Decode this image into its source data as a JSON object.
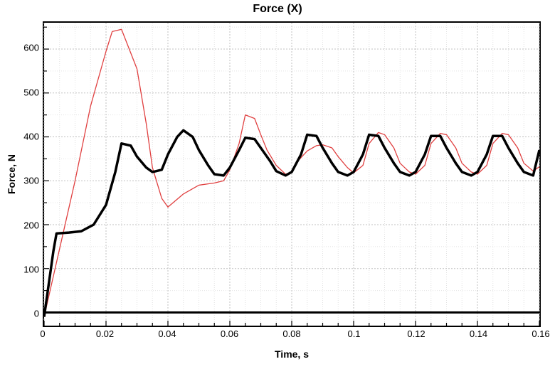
{
  "chart_data": {
    "type": "line",
    "title": "Force (X)",
    "xlabel": "Time, s",
    "ylabel": "Force, N",
    "xlim": [
      0,
      0.16
    ],
    "ylim": [
      -30,
      660
    ],
    "x_ticks_major": [
      0,
      0.02,
      0.04,
      0.06,
      0.08,
      0.1,
      0.12,
      0.14,
      0.16
    ],
    "x_tick_labels": [
      "0",
      "0.02",
      "0.04",
      "0.06",
      "0.08",
      "0.1",
      "0.12",
      "0.14",
      "0.16"
    ],
    "x_ticks_minor": [
      0.005,
      0.01,
      0.015,
      0.025,
      0.03,
      0.035,
      0.045,
      0.05,
      0.055,
      0.065,
      0.07,
      0.075,
      0.085,
      0.09,
      0.095,
      0.105,
      0.11,
      0.115,
      0.125,
      0.13,
      0.135,
      0.145,
      0.15,
      0.155
    ],
    "y_ticks_major": [
      0,
      100,
      200,
      300,
      400,
      500,
      600
    ],
    "y_tick_labels": [
      "0",
      "100",
      "200",
      "300",
      "400",
      "500",
      "600"
    ],
    "y_ticks_minor": [
      50,
      150,
      250,
      350,
      450,
      550,
      650
    ],
    "zero_line_y": 0,
    "series": [
      {
        "name": "series-0",
        "color": "#e04040",
        "lw": 1.3,
        "x": [
          0.0,
          0.005,
          0.01,
          0.015,
          0.02,
          0.022,
          0.025,
          0.03,
          0.033,
          0.035,
          0.038,
          0.04,
          0.045,
          0.05,
          0.055,
          0.058,
          0.06,
          0.063,
          0.065,
          0.068,
          0.07,
          0.072,
          0.075,
          0.078,
          0.08,
          0.082,
          0.085,
          0.088,
          0.09,
          0.093,
          0.095,
          0.098,
          0.1,
          0.103,
          0.105,
          0.108,
          0.11,
          0.113,
          0.115,
          0.118,
          0.12,
          0.123,
          0.125,
          0.128,
          0.13,
          0.133,
          0.135,
          0.138,
          0.14,
          0.143,
          0.145,
          0.148,
          0.15,
          0.153,
          0.155,
          0.158,
          0.16
        ],
        "y": [
          -10,
          145,
          300,
          470,
          595,
          640,
          645,
          555,
          430,
          330,
          260,
          240,
          270,
          290,
          295,
          300,
          325,
          385,
          450,
          442,
          405,
          370,
          335,
          315,
          320,
          345,
          368,
          380,
          382,
          375,
          355,
          330,
          318,
          335,
          385,
          410,
          405,
          375,
          340,
          320,
          315,
          335,
          385,
          408,
          405,
          375,
          340,
          320,
          315,
          335,
          385,
          408,
          405,
          375,
          340,
          322,
          332
        ]
      },
      {
        "name": "series-1",
        "color": "#000000",
        "lw": 3.5,
        "x": [
          0.0,
          0.003,
          0.004,
          0.008,
          0.012,
          0.016,
          0.02,
          0.023,
          0.025,
          0.028,
          0.03,
          0.033,
          0.035,
          0.038,
          0.04,
          0.043,
          0.045,
          0.048,
          0.05,
          0.053,
          0.055,
          0.058,
          0.06,
          0.063,
          0.065,
          0.068,
          0.07,
          0.073,
          0.075,
          0.078,
          0.08,
          0.083,
          0.085,
          0.088,
          0.09,
          0.093,
          0.095,
          0.098,
          0.1,
          0.103,
          0.105,
          0.108,
          0.11,
          0.113,
          0.115,
          0.118,
          0.12,
          0.123,
          0.125,
          0.128,
          0.13,
          0.133,
          0.135,
          0.138,
          0.14,
          0.143,
          0.145,
          0.148,
          0.15,
          0.153,
          0.155,
          0.158,
          0.16
        ],
        "y": [
          -10,
          140,
          180,
          182,
          185,
          200,
          245,
          320,
          385,
          380,
          355,
          330,
          320,
          325,
          360,
          400,
          415,
          400,
          370,
          335,
          315,
          312,
          330,
          370,
          398,
          395,
          375,
          345,
          322,
          312,
          320,
          360,
          405,
          402,
          375,
          340,
          320,
          312,
          320,
          360,
          405,
          402,
          375,
          340,
          320,
          312,
          320,
          360,
          402,
          402,
          375,
          340,
          320,
          312,
          320,
          360,
          402,
          402,
          375,
          340,
          320,
          312,
          370
        ]
      }
    ]
  }
}
